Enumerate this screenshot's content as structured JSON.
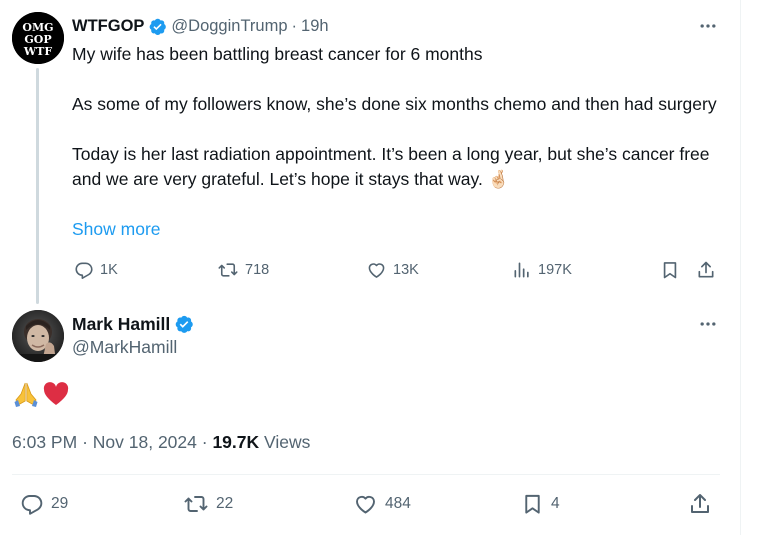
{
  "parent_tweet": {
    "avatar_text": [
      "OMG",
      "GOP",
      "WTF"
    ],
    "display_name": "WTFGOP",
    "handle": "@DogginTrump",
    "separator": "·",
    "time_ago": "19h",
    "paragraphs": [
      "My wife has been battling breast cancer for 6 months",
      "As some of my followers know, she’s done six months chemo and then had surgery",
      "Today is her last radiation appointment. It’s been a long year, but she’s cancer free and we are very grateful. Let’s hope it stays that way. 🤞🏻"
    ],
    "show_more": "Show more",
    "stats": {
      "replies": "1K",
      "reposts": "718",
      "likes": "13K",
      "views": "197K"
    }
  },
  "main_tweet": {
    "display_name": "Mark Hamill",
    "handle": "@MarkHamill",
    "text": [
      "🙏",
      "❤"
    ],
    "time": "6:03 PM",
    "date": "Nov 18, 2024",
    "separator": "·",
    "views_count": "19.7K",
    "views_label": "Views",
    "stats": {
      "replies": "29",
      "reposts": "22",
      "likes": "484",
      "bookmarks": "4"
    }
  },
  "colors": {
    "text_primary": "#0f1419",
    "text_secondary": "#536471",
    "link": "#1d9bf0",
    "verified": "#1d9bf0",
    "thread_line": "#cfd9de",
    "divider": "#eff3f4",
    "heart": "#dd2e44",
    "prayer_hands": "#f8c23a"
  },
  "icons": {
    "verified": "verified-badge-icon",
    "more": "more-horizontal-icon",
    "reply": "reply-bubble-icon",
    "repost": "repost-arrows-icon",
    "like": "heart-outline-icon",
    "views": "views-bar-chart-icon",
    "bookmark": "bookmark-icon",
    "share": "share-upload-icon"
  }
}
